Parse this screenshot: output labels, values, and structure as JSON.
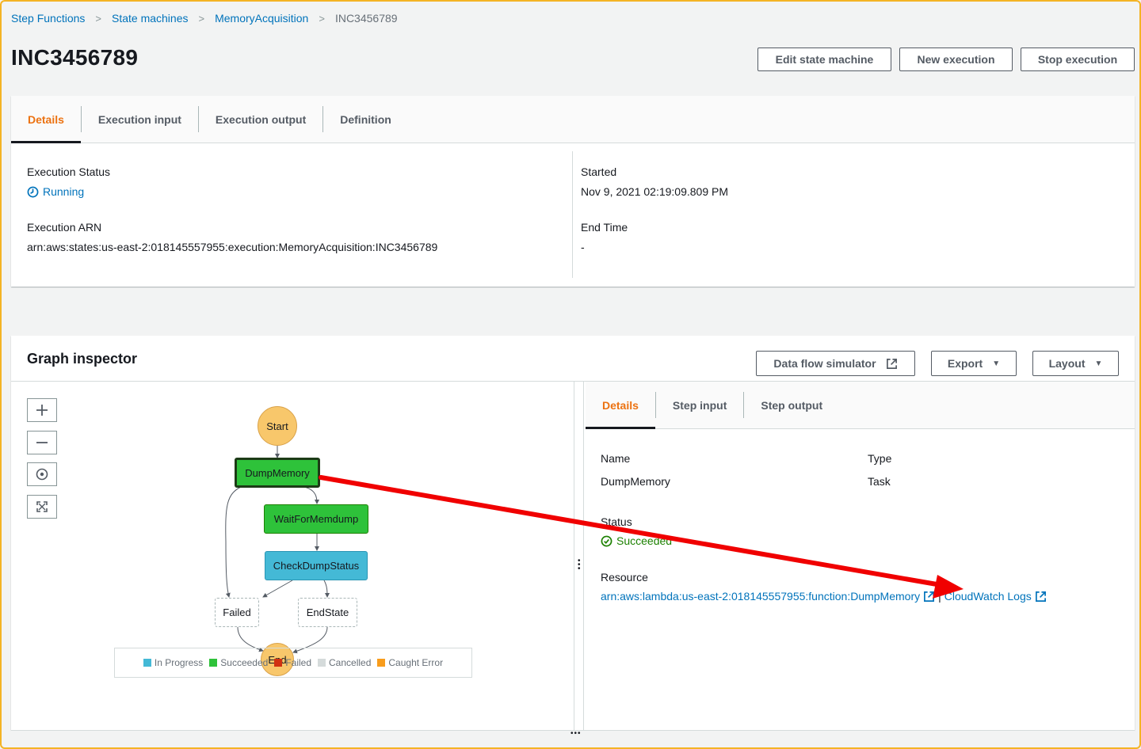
{
  "breadcrumb": {
    "items": [
      "Step Functions",
      "State machines",
      "MemoryAcquisition"
    ],
    "current": "INC3456789"
  },
  "page": {
    "title": "INC3456789"
  },
  "header_buttons": {
    "edit": "Edit state machine",
    "new": "New execution",
    "stop": "Stop execution"
  },
  "details_panel": {
    "tabs": [
      "Details",
      "Execution input",
      "Execution output",
      "Definition"
    ],
    "active_tab": "Details",
    "execution_status_label": "Execution Status",
    "execution_status": "Running",
    "execution_arn_label": "Execution ARN",
    "execution_arn": "arn:aws:states:us-east-2:018145557955:execution:MemoryAcquisition:INC3456789",
    "started_label": "Started",
    "started": "Nov 9, 2021 02:19:09.809 PM",
    "end_time_label": "End Time",
    "end_time": "-"
  },
  "graph_inspector": {
    "title": "Graph inspector",
    "buttons": {
      "simulator": "Data flow simulator",
      "export": "Export",
      "layout": "Layout"
    },
    "nodes": {
      "start": "Start",
      "dump": "DumpMemory",
      "wait": "WaitForMemdump",
      "check": "CheckDumpStatus",
      "failed": "Failed",
      "endstate": "EndState",
      "end": "End"
    },
    "legend": [
      {
        "label": "In Progress",
        "color": "#44b9d6"
      },
      {
        "label": "Succeeded",
        "color": "#2ec23a"
      },
      {
        "label": "Failed",
        "color": "#d13212"
      },
      {
        "label": "Cancelled",
        "color": "#d5dbdb"
      },
      {
        "label": "Caught Error",
        "color": "#f89c1c"
      }
    ],
    "step_tabs": [
      "Details",
      "Step input",
      "Step output"
    ],
    "active_step_tab": "Details",
    "step": {
      "name_label": "Name",
      "name": "DumpMemory",
      "type_label": "Type",
      "type": "Task",
      "status_label": "Status",
      "status": "Succeeded",
      "resource_label": "Resource",
      "resource_arn": "arn:aws:lambda:us-east-2:018145557955:function:DumpMemory",
      "separator": "|",
      "cloudwatch": "CloudWatch Logs"
    }
  },
  "colors": {
    "accent_orange": "#ec7211",
    "link_blue": "#0073bb",
    "success_green": "#1d8102",
    "annotation_red": "#f00000",
    "frame_yellow": "#f4b324"
  }
}
